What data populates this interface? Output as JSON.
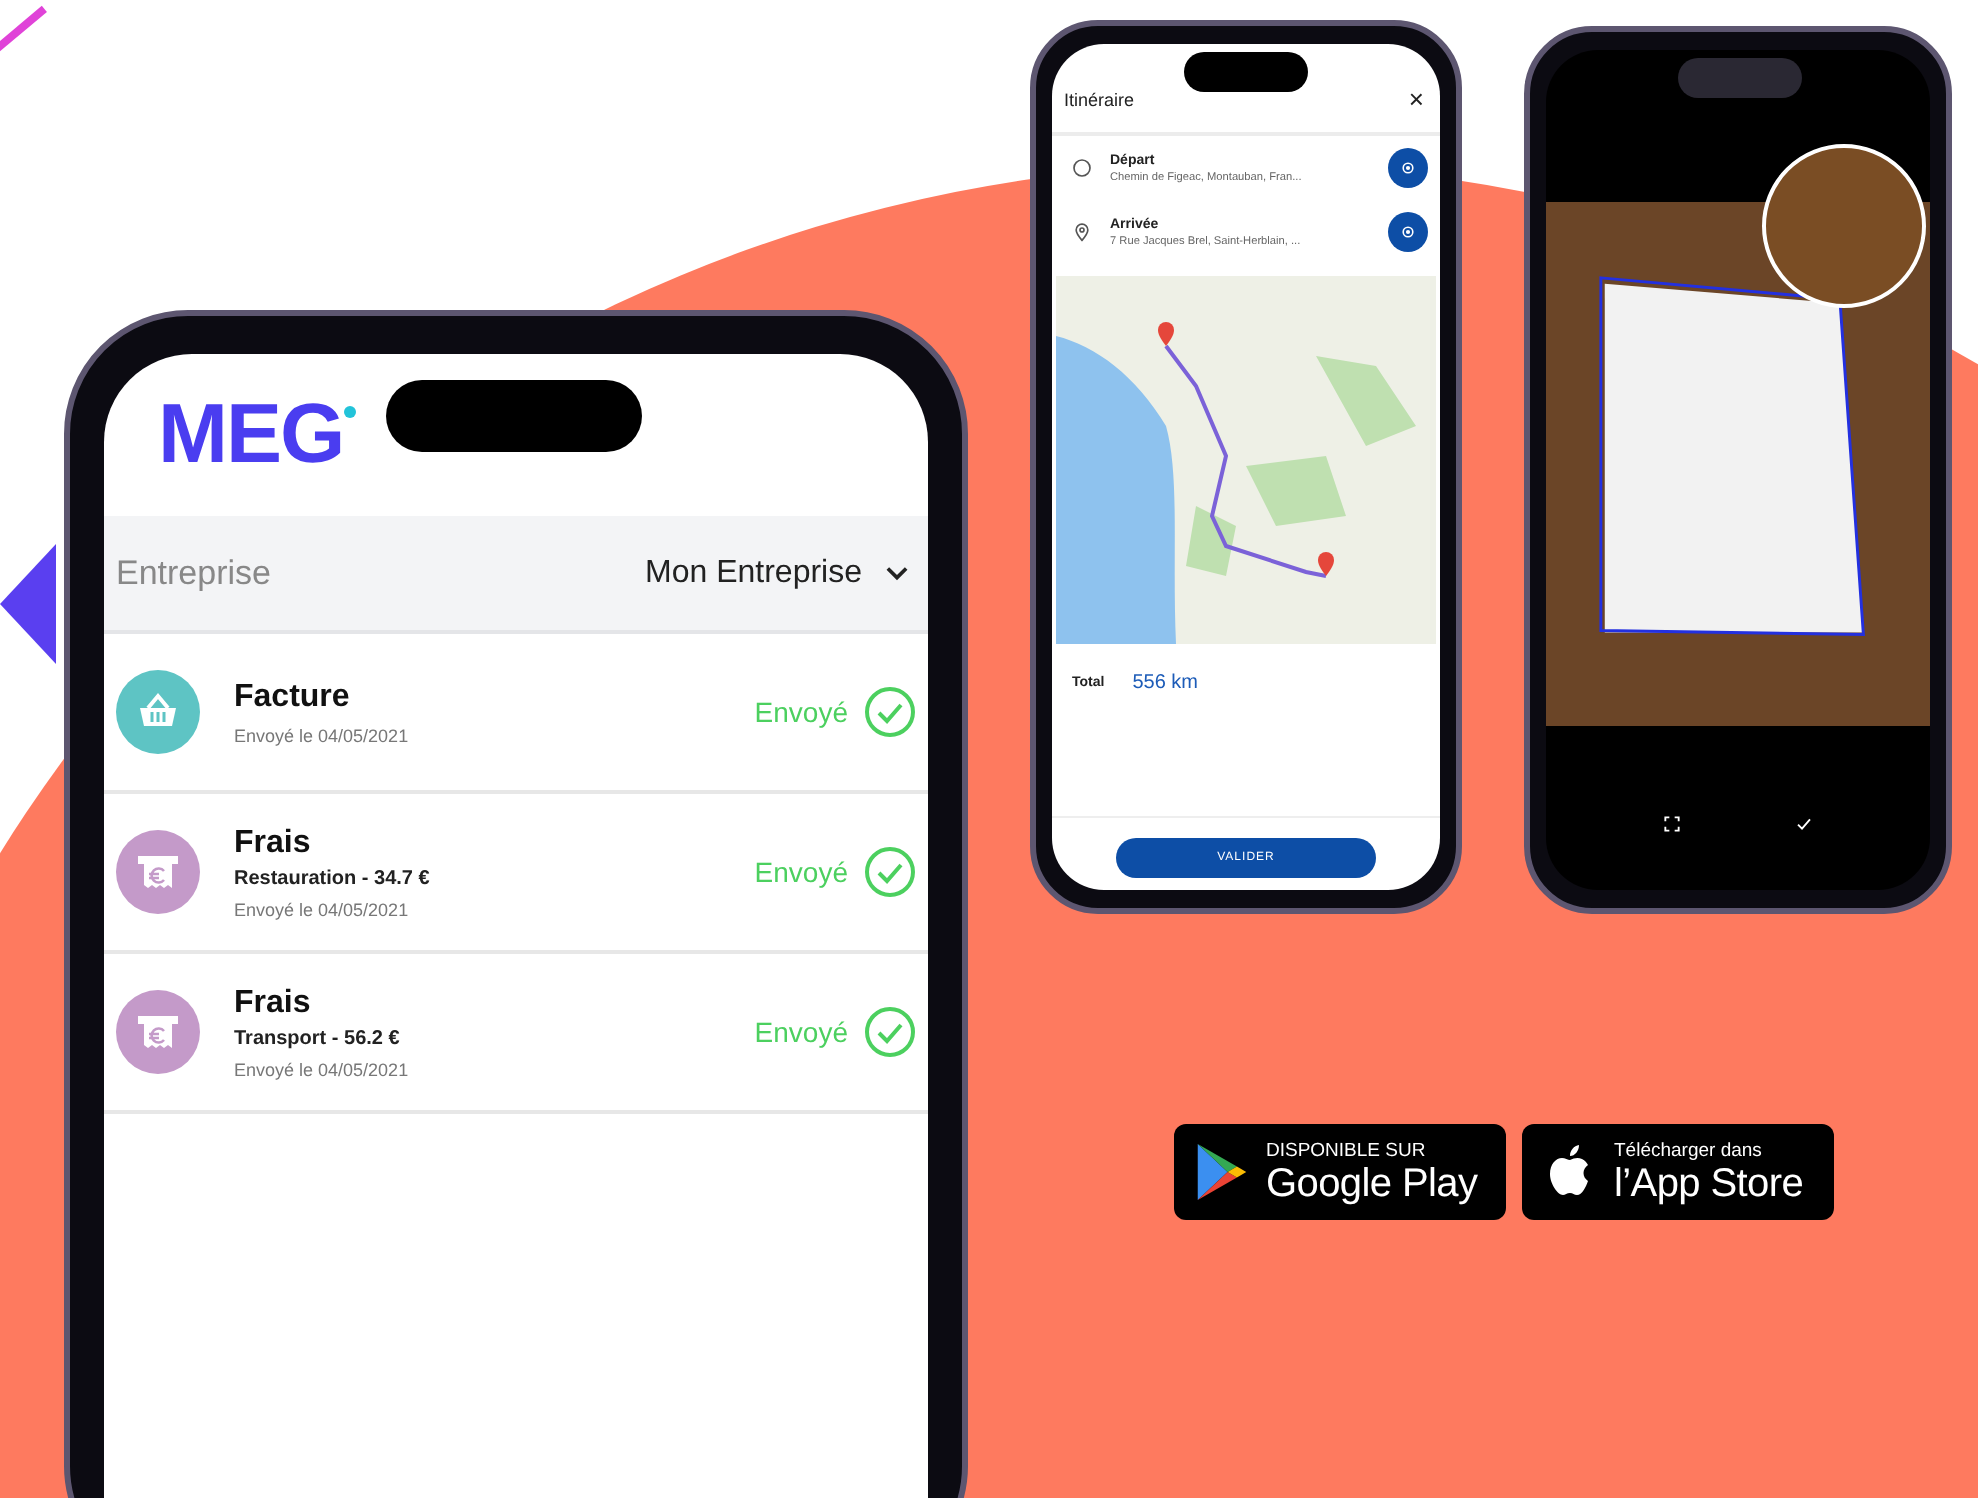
{
  "expense_phone": {
    "logo": "MEG",
    "company": {
      "label": "Entreprise",
      "value": "Mon Entreprise"
    },
    "items": [
      {
        "kind": "invoice",
        "title": "Facture",
        "date": "Envoyé le 04/05/2021",
        "status": "Envoyé"
      },
      {
        "kind": "expense",
        "title": "Frais",
        "detail": "Restauration - 34.7 €",
        "date": "Envoyé le 04/05/2021",
        "status": "Envoyé"
      },
      {
        "kind": "expense",
        "title": "Frais",
        "detail": "Transport - 56.2 €",
        "date": "Envoyé le 04/05/2021",
        "status": "Envoyé"
      }
    ]
  },
  "itinerary_phone": {
    "title": "Itinéraire",
    "close": "×",
    "stops": [
      {
        "kind": "start",
        "label": "Départ",
        "address": "Chemin de Figeac, Montauban, Fran..."
      },
      {
        "kind": "end",
        "label": "Arrivée",
        "address": "7 Rue Jacques Brel, Saint-Herblain, ..."
      }
    ],
    "total_label": "Total",
    "total_value": "556 km",
    "button": "VALIDER"
  },
  "store_badges": [
    {
      "kind": "google",
      "small": "DISPONIBLE SUR",
      "large": "Google Play"
    },
    {
      "kind": "apple",
      "small": "Télécharger dans",
      "large": "l’App Store"
    }
  ]
}
